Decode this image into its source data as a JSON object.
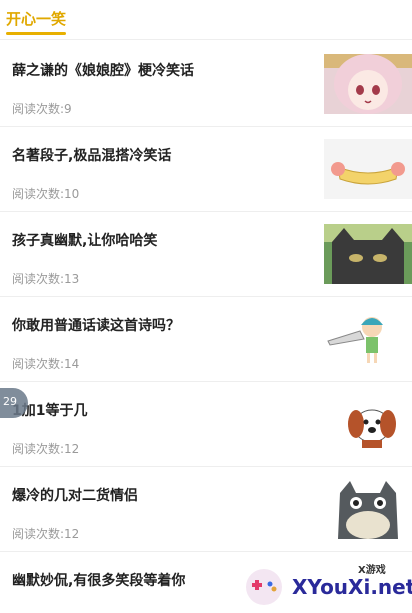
{
  "header": {
    "tab_label": "开心一笑"
  },
  "meta_prefix": "阅读次数:",
  "items": [
    {
      "title": "薛之谦的《娘娘腔》梗冷笑话",
      "reads": "9",
      "thumb": "anime-girl-image"
    },
    {
      "title": "名著段子,极品混搭冷笑话",
      "reads": "10",
      "thumb": "banner-ribbon-image"
    },
    {
      "title": "孩子真幽默,让你哈哈笑",
      "reads": "13",
      "thumb": "black-cat-image"
    },
    {
      "title": "你敢用普通话读这首诗吗？",
      "reads": "14",
      "thumb": "cartoon-kid-image"
    },
    {
      "title": "1加1等于几",
      "reads": "12",
      "thumb": "cartoon-dog-image"
    },
    {
      "title": "爆冷的几对二货情侣",
      "reads": "12",
      "thumb": "totoro-image"
    },
    {
      "title": "幽默妙侃,有很多笑段等着你",
      "reads": "",
      "thumb": ""
    }
  ],
  "float_button": {
    "label": "29"
  },
  "watermark": {
    "text": "XYouXi.net",
    "sub": "X游戏"
  },
  "colors": {
    "accent": "#e8b000",
    "title": "#222222",
    "meta": "#9a9a9a"
  }
}
